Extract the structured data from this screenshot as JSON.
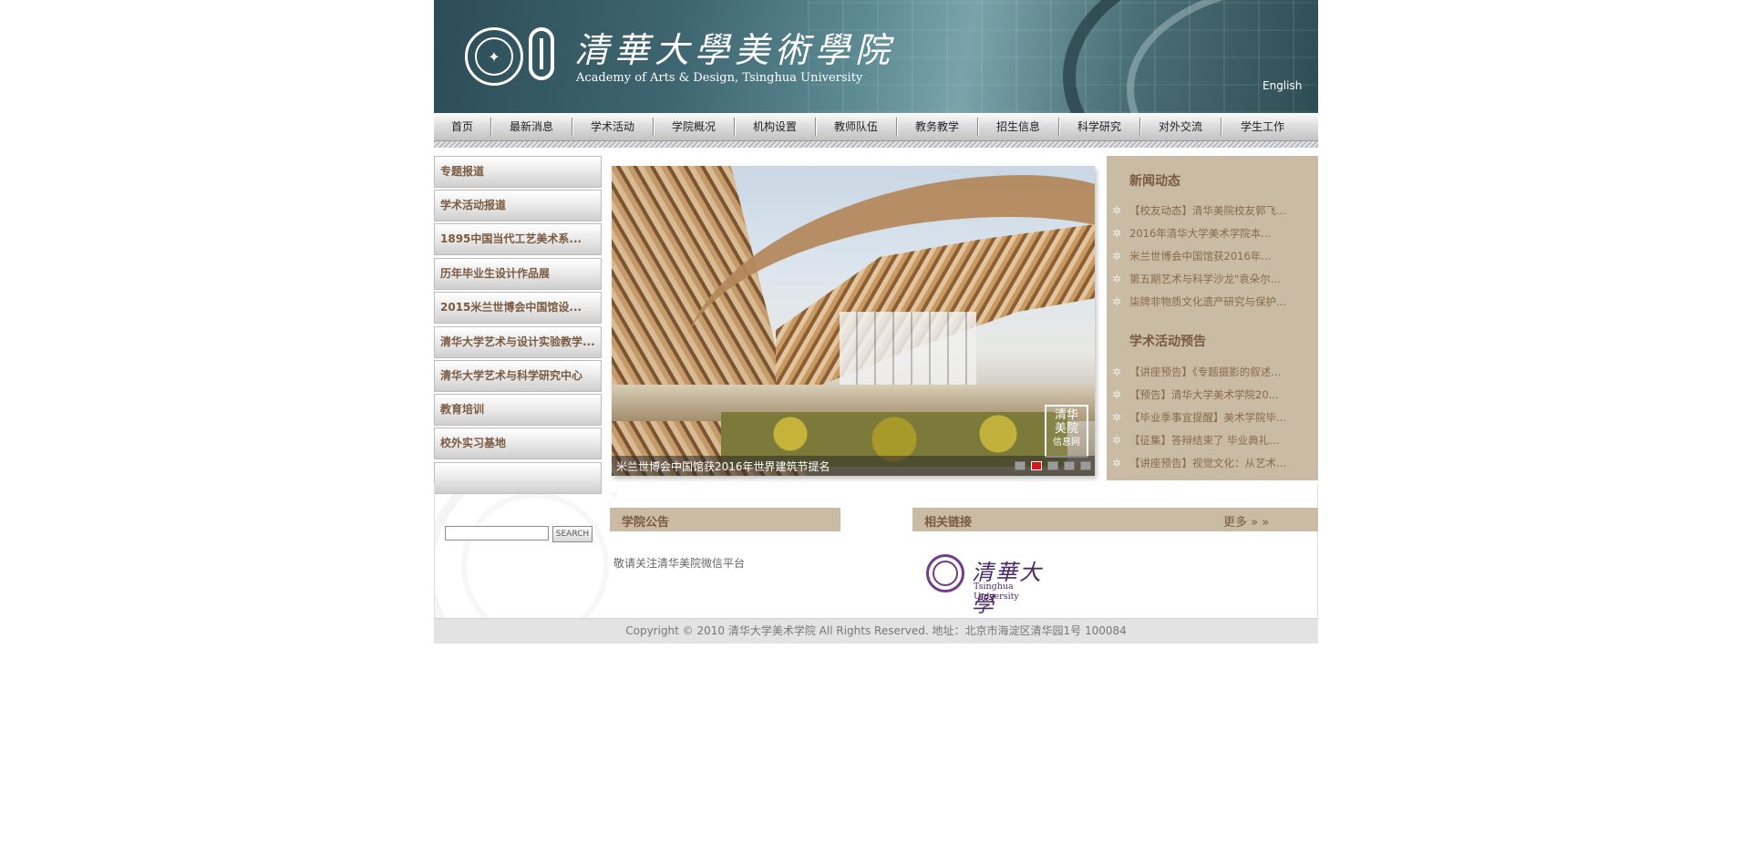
{
  "header": {
    "logo_cn": "清華大學美術學院",
    "logo_en": "Academy of Arts & Design, Tsinghua University",
    "english_link": "English"
  },
  "nav": {
    "items": [
      "首页",
      "最新消息",
      "学术活动",
      "学院概况",
      "机构设置",
      "教师队伍",
      "教务教学",
      "招生信息",
      "科学研究",
      "对外交流",
      "学生工作"
    ]
  },
  "sidebar": {
    "items": [
      "专题报道",
      "学术活动报道",
      "1895中国当代工艺美术系...",
      "历年毕业生设计作品展",
      "2015米兰世博会中国馆设...",
      "清华大学艺术与设计实验教学...",
      "清华大学艺术与科学研究中心",
      "教育培训",
      "校外实习基地",
      ""
    ],
    "search_placeholder": "",
    "search_button": "SEARCH"
  },
  "slideshow": {
    "caption": "米兰世博会中国馆获2016年世界建筑节提名",
    "badge_line1": "清华",
    "badge_line2": "美院",
    "badge_line3": "信息网",
    "dot_count": 5,
    "active_dot_index": 1
  },
  "right_panel": {
    "news_title": "新闻动态",
    "news_items": [
      "【校友动态】清华美院校友郭飞...",
      "2016年清华大学美术学院本...",
      "米兰世博会中国馆获2016年...",
      "第五期艺术与科学沙龙\"袁朵尔...",
      "柒牌非物质文化遗产研究与保护..."
    ],
    "events_title": "学术活动预告",
    "events_items": [
      "【讲座预告】《专题摄影的叙述...",
      "【预告】清华大学美术学院20...",
      "【毕业季事宜提醒】美术学院毕...",
      "【征集】答辩结束了 毕业典礼...",
      "【讲座预告】视觉文化：从艺术..."
    ]
  },
  "notices": {
    "title": "学院公告",
    "item": "敬请关注清华美院微信平台"
  },
  "links": {
    "title": "相关链接",
    "more": "更多 » »",
    "logo_cn": "清華大學",
    "logo_en": "Tsinghua University"
  },
  "footer": {
    "text": "Copyright © 2010 清华大学美术学院 All Rights Reserved. 地址：北京市海淀区清华园1号 100084"
  },
  "colors": {
    "accent_brown": "#7a5a41",
    "panel_tan": "#c9bba4",
    "active_dot": "#d8171c"
  }
}
